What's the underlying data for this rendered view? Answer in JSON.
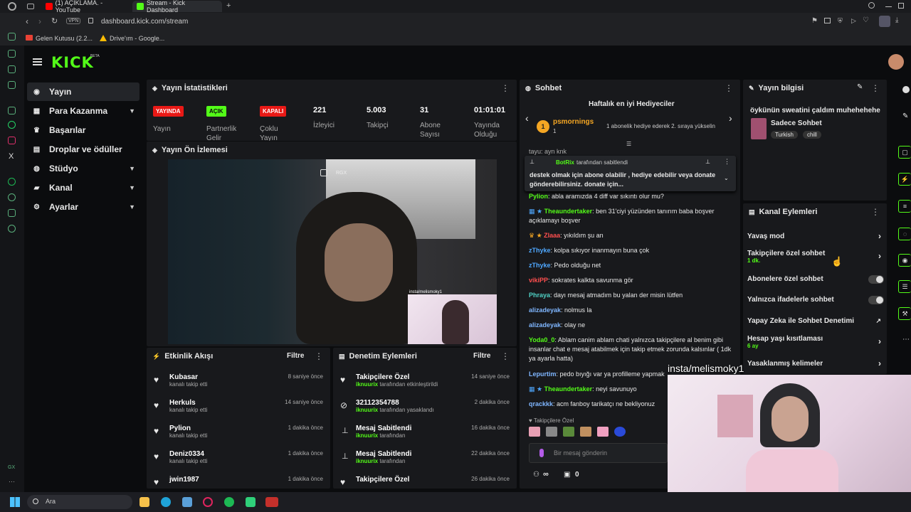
{
  "browser": {
    "tabs": [
      {
        "label": "(1) AÇIKLAMA. - YouTube"
      },
      {
        "label": "Stream - Kick Dashboard"
      }
    ],
    "url": "dashboard.kick.com/stream",
    "vpn": "VPN",
    "bookmarks": [
      {
        "label": "Gelen Kutusu (2.2..."
      },
      {
        "label": "Drive'ım - Google..."
      }
    ]
  },
  "logo": "KICK",
  "logo_beta": "BETA",
  "nav": [
    {
      "label": "Yayın",
      "icon": "broadcast-icon"
    },
    {
      "label": "Para Kazanma",
      "icon": "money-icon"
    },
    {
      "label": "Başarılar",
      "icon": "trophy-icon"
    },
    {
      "label": "Droplar ve ödüller",
      "icon": "drops-icon"
    },
    {
      "label": "Stüdyo",
      "icon": "studio-icon"
    },
    {
      "label": "Kanal",
      "icon": "channel-icon"
    },
    {
      "label": "Ayarlar",
      "icon": "gear-icon"
    }
  ],
  "stats": {
    "title": "Yayın İstatistikleri",
    "live_badge": "YAYINDA",
    "live_label": "Yayın",
    "partner_badge": "AÇIK",
    "partner_label": "Partnerlik Gelir",
    "multi_badge": "KAPALI",
    "multi_label": "Çoklu Yayın",
    "viewers": "221",
    "viewers_label": "İzleyici",
    "followers": "5.003",
    "followers_label": "Takipçi",
    "subs": "31",
    "subs_label": "Abone Sayısı",
    "uptime": "01:01:01",
    "uptime_label": "Yayında Olduğu"
  },
  "preview": {
    "title": "Yayın Ön İzlemesi",
    "overlay": "insta/melismoky1",
    "rgx": "RGX"
  },
  "activity": {
    "title": "Etkinlik Akışı",
    "filter": "Filtre",
    "items": [
      {
        "name": "Kubasar",
        "sub": "kanalı takip etti",
        "time": "8 saniye önce"
      },
      {
        "name": "Herkuls",
        "sub": "kanalı takip etti",
        "time": "14 saniye önce"
      },
      {
        "name": "Pylion",
        "sub": "kanalı takip etti",
        "time": "1 dakika önce"
      },
      {
        "name": "Deniz0334",
        "sub": "kanalı takip etti",
        "time": "1 dakika önce"
      },
      {
        "name": "jwin1987",
        "sub": "",
        "time": "1 dakika önce"
      }
    ]
  },
  "moderation": {
    "title": "Denetim Eylemleri",
    "filter": "Filtre",
    "items": [
      {
        "name": "Takipçilere Özel",
        "by": "iknuurix",
        "sub": "tarafından etkinleştirildi",
        "time": "14 saniye önce"
      },
      {
        "name": "32112354788",
        "by": "iknuurix",
        "sub": "tarafından yasaklandı",
        "time": "2 dakika önce"
      },
      {
        "name": "Mesaj Sabitlendi",
        "by": "iknuurix",
        "sub": "tarafından",
        "time": "16 dakika önce"
      },
      {
        "name": "Mesaj Sabitlendi",
        "by": "iknuurix",
        "sub": "tarafından",
        "time": "22 dakika önce"
      },
      {
        "name": "Takipçilere Özel",
        "by": "",
        "sub": "",
        "time": "26 dakika önce"
      }
    ]
  },
  "chat": {
    "title": "Sohbet",
    "gifters_title": "Haftalık en iyi Hediyeciler",
    "gifter_rank": "1",
    "gifter_name": "psmornings",
    "gifter_count": "1",
    "gifter_note": "1 abonelik hediye ederek 2. sıraya yükselin",
    "pinned_by": "BotRix",
    "pinned_suffix": "tarafından sabitlendi",
    "pinned_text": "destek olmak için abone olabilir , hediye edebilir veya donate gönderebilirsiniz. donate için...",
    "partial_top": "tayu: ayn knk",
    "messages": [
      {
        "user": "Pylion",
        "color": "#53fc18",
        "text": "abla aramızda 4 diff var sıkıntı olur mu?"
      },
      {
        "user": "Theaundertaker",
        "color": "#53fc18",
        "text": "ben 31'ciyi yüzünden tanırım baba boşver açıklamayı boşver"
      },
      {
        "user": "Zlaaa",
        "color": "#ff4f4f",
        "text": "yıkıldım şu an"
      },
      {
        "user": "zThyke",
        "color": "#4fa8ff",
        "text": "kolpa sıkıyor inanmayın buna çok"
      },
      {
        "user": "zThyke",
        "color": "#4fa8ff",
        "text": "Pedo olduğu net"
      },
      {
        "user": "vikiPP",
        "color": "#ff4f4f",
        "text": "sokrates kalkta savunma gör"
      },
      {
        "user": "Phraya",
        "color": "#4fd1c5",
        "text": "dayı mesaj atmadım bu yalan der misin lütfen"
      },
      {
        "user": "alizadeyak",
        "color": "#7fb6ff",
        "text": "nolmus la"
      },
      {
        "user": "alizadeyak",
        "color": "#7fb6ff",
        "text": "olay ne"
      },
      {
        "user": "Yoda0_0",
        "color": "#53fc18",
        "text": "Ablam canim ablam chati yalnızca takipçilere al benim gibi insanlar chat e mesaj atabilmek için takip etmek zorunda kalsınlar ( 1dk ya ayarla hatta)"
      },
      {
        "user": "Lepurtim",
        "color": "#7fb6ff",
        "text": "pedo bıyığı var ya profilleme yapmak istiyorum ama"
      },
      {
        "user": "Theaundertaker",
        "color": "#53fc18",
        "text": "neyi savunuyo"
      },
      {
        "user": "qrackkk",
        "color": "#7fb6ff",
        "text": "acm fanboy tarikatçı ne bekliyonuz"
      }
    ],
    "followers_only": "Takipçilere Özel",
    "input_placeholder": "Bir mesaj gönderin",
    "points": "∞",
    "gifts": "0"
  },
  "stream_info": {
    "title": "Yayın bilgisi",
    "stream_title": "öykünün sweatini çaldım muhehehehe",
    "category": "Sadece Sohbet",
    "tags": [
      "Turkish",
      "chill"
    ]
  },
  "channel_actions": {
    "title": "Kanal Eylemleri",
    "items": [
      {
        "label": "Yavaş mod",
        "sub": "",
        "control": "chevron"
      },
      {
        "label": "Takipçilere özel sohbet",
        "sub": "1 dk.",
        "control": "chevron"
      },
      {
        "label": "Abonelere özel sohbet",
        "sub": "",
        "control": "toggle"
      },
      {
        "label": "Yalnızca ifadelerle sohbet",
        "sub": "",
        "control": "toggle"
      },
      {
        "label": "Yapay Zeka ile Sohbet Denetimi",
        "sub": "",
        "control": "external"
      },
      {
        "label": "Hesap yaşı kısıtlaması",
        "sub": "6 ay",
        "control": "chevron"
      },
      {
        "label": "Yasaklanmış kelimeler",
        "sub": "",
        "control": "chevron"
      }
    ]
  },
  "facecam_overlay": "insta/melismoky1",
  "taskbar": {
    "search_placeholder": "Ara"
  },
  "colors": {
    "kick_green": "#53fc18",
    "live_red": "#e91916",
    "panel": "#18191c"
  }
}
